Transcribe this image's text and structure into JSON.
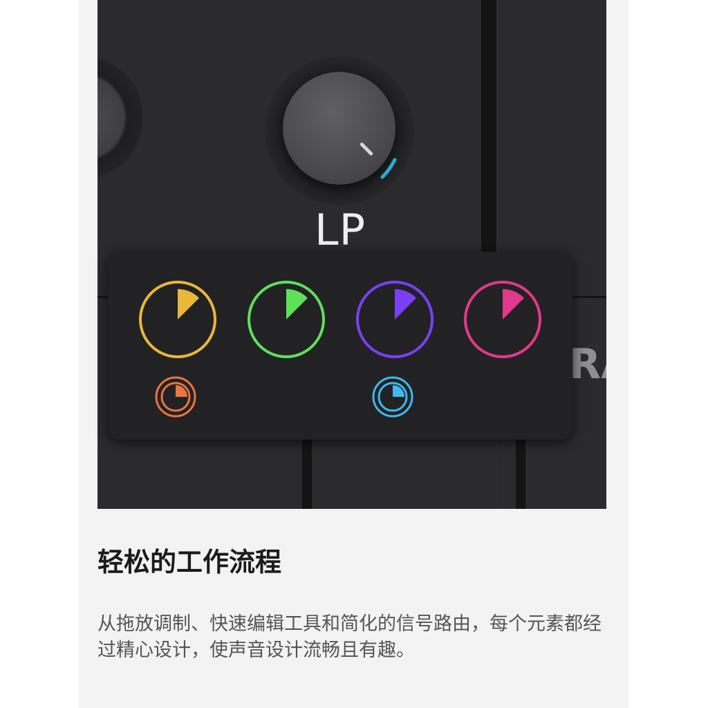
{
  "panel": {
    "knob_label": "LP",
    "peek_text": "RA",
    "modulators": [
      {
        "name": "yellow-modulator",
        "color": "#e9b73a"
      },
      {
        "name": "green-modulator",
        "color": "#5ee05a"
      },
      {
        "name": "purple-modulator",
        "color": "#7a3ff5"
      },
      {
        "name": "pink-modulator",
        "color": "#e2388e"
      }
    ],
    "small_modulators": [
      {
        "name": "orange-small-modulator",
        "color": "#e9763f"
      },
      {
        "name": "blue-small-modulator",
        "color": "#40b9ee"
      }
    ],
    "accent_color": "#2fb4e8"
  },
  "content": {
    "title": "轻松的工作流程",
    "description": "从拖放调制、快速编辑工具和简化的信号路由，每个元素都经过精心设计，使声音设计流畅且有趣。"
  }
}
